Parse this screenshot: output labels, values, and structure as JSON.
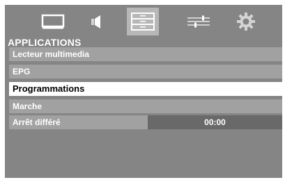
{
  "tabs": [
    {
      "icon": "monitor-icon",
      "active": false
    },
    {
      "icon": "speaker-icon",
      "active": false
    },
    {
      "icon": "applications-icon",
      "active": true
    },
    {
      "icon": "settings-sliders-icon",
      "active": false
    },
    {
      "icon": "gear-icon",
      "active": false
    }
  ],
  "section": {
    "title": "APPLICATIONS"
  },
  "menu": {
    "items": [
      {
        "label": "Lecteur multimedia"
      },
      {
        "label": "EPG"
      },
      {
        "label": "Programmations",
        "selected": true
      },
      {
        "label": "Marche"
      },
      {
        "label": "Arrêt différé",
        "value": "00:00"
      }
    ]
  },
  "colors": {
    "background": "#858585",
    "item": "#a1a1a1",
    "selected_item": "#ffffff",
    "value_field": "#696969",
    "active_tab": "#b7b7b7"
  }
}
